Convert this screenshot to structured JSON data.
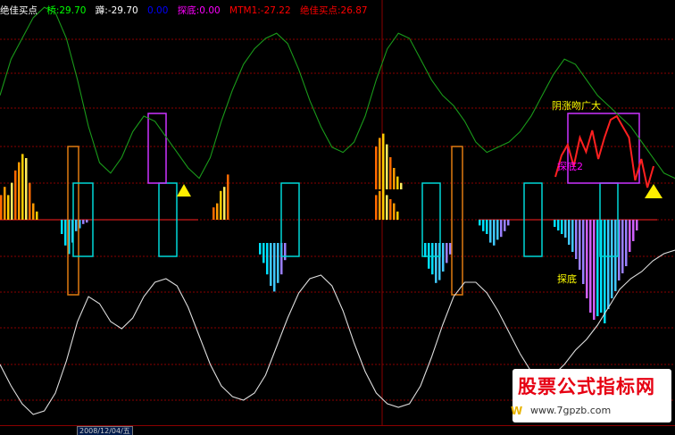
{
  "legend": [
    {
      "text": "绝佳买点",
      "color": "#ffffff"
    },
    {
      "text": "桥:29.70",
      "color": "#00ff00"
    },
    {
      "text": "蹲:-29.70",
      "color": "#ffffff"
    },
    {
      "text": "0.00",
      "color": "#0000ff"
    },
    {
      "text": "探底:0.00",
      "color": "#ff00ff"
    },
    {
      "text": "MTM1:-27.22",
      "color": "#ff0000"
    },
    {
      "text": "绝佳买点:26.87",
      "color": "#ff0000"
    }
  ],
  "annotations": [
    {
      "text": "阴涨吻广大",
      "color": "#ffff00"
    },
    {
      "text": "探底2",
      "color": "#ff00ff"
    },
    {
      "text": "探底",
      "color": "#ffff00"
    }
  ],
  "watermark": {
    "title": "股票公式指标网",
    "url": "www.7gpzb.com",
    "logo": "W"
  },
  "x_axis": {
    "labels": [
      "2008/12/04/五"
    ]
  },
  "colors": {
    "grid": "#8a0000",
    "green_line": "#1a9a1a",
    "white_line": "#dddddd",
    "red_line": "#ff2020",
    "cyan_box": "#00d8d8",
    "orange_box": "#e07a10",
    "magenta_box": "#cc33ff",
    "warm_bars": [
      "#ff6a00",
      "#ff9a00",
      "#ffcc00",
      "#ffee60"
    ],
    "cool_bars": [
      "#00e0ff",
      "#40c8ff",
      "#9a80ff",
      "#d060ff"
    ],
    "triangle": "#ffee00"
  },
  "chart_data": {
    "type": "line",
    "title": "",
    "xlabel": "",
    "ylabel": "",
    "zero_level": 0,
    "ylim": [
      -60,
      60
    ],
    "segments": [
      {
        "pos": [
          12,
          16,
          12,
          18,
          24,
          28,
          32,
          30,
          18,
          8,
          4
        ],
        "neg": []
      },
      {
        "pos": [],
        "neg": [
          -10,
          -18,
          -24,
          -16,
          -8,
          -6,
          -3,
          -2
        ]
      },
      {
        "pos": [
          6,
          8,
          14,
          16,
          22
        ],
        "neg": []
      },
      {
        "pos": [],
        "neg": [
          -8,
          -14,
          -22,
          -30,
          -34,
          -28,
          -22,
          -12
        ]
      },
      {
        "pos": [
          12,
          14,
          16,
          12,
          10,
          8,
          4
        ],
        "neg": []
      },
      {
        "pos": [],
        "neg": [
          -10,
          -18,
          -22,
          -28,
          -26,
          -20,
          -14,
          -8
        ]
      },
      {
        "pos": [
          40,
          48,
          52,
          42,
          30,
          20,
          12,
          6
        ],
        "neg": []
      },
      {
        "pos": [],
        "neg": [
          -4,
          -8,
          -10,
          -16,
          -18,
          -14,
          -12,
          -8,
          -4
        ]
      },
      {
        "pos": [],
        "neg": [
          -4,
          -6,
          -8,
          -10,
          -14,
          -18,
          -22,
          -28,
          -36,
          -44,
          -52,
          -56,
          -54,
          -52,
          -58,
          -50,
          -44,
          -40,
          -34,
          -30,
          -26,
          -18,
          -12,
          -6
        ]
      }
    ],
    "series": [
      {
        "values": [
          48,
          62,
          70,
          78,
          82,
          80,
          70,
          54,
          36,
          22,
          18,
          24,
          34,
          40,
          38,
          32,
          26,
          20,
          16,
          24,
          38,
          50,
          60,
          66,
          70,
          72,
          68,
          58,
          46,
          36,
          28,
          26,
          30,
          40,
          54,
          66,
          72,
          70,
          62,
          54,
          48,
          44,
          38,
          30,
          26,
          28,
          30,
          34,
          40,
          48,
          56,
          62,
          60,
          54,
          48,
          44,
          40,
          36,
          30,
          24,
          18,
          16
        ]
      },
      {
        "values": [
          -54,
          -66,
          -76,
          -82,
          -80,
          -70,
          -52,
          -30,
          -16,
          -20,
          -30,
          -34,
          -28,
          -16,
          -8,
          -6,
          -10,
          -22,
          -38,
          -54,
          -66,
          -72,
          -74,
          -70,
          -60,
          -44,
          -28,
          -14,
          -6,
          -4,
          -10,
          -24,
          -42,
          -58,
          -70,
          -76,
          -78,
          -76,
          -66,
          -50,
          -32,
          -16,
          -8,
          -8,
          -14,
          -24,
          -36,
          -48,
          -58,
          -62,
          -60,
          -54,
          -46,
          -40,
          -32,
          -22,
          -12,
          -6,
          -2,
          4,
          8,
          10
        ]
      },
      {
        "values": [
          24,
          36,
          42,
          30,
          46,
          38,
          50,
          34,
          46,
          56,
          58,
          52,
          46,
          22,
          34,
          18,
          30
        ]
      }
    ]
  }
}
